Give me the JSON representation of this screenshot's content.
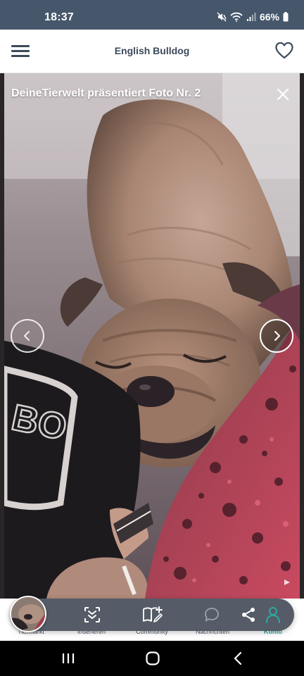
{
  "status_bar": {
    "time": "18:37",
    "battery": "66%",
    "icons": [
      "mute-icon",
      "wifi-icon",
      "signal-icon",
      "battery-icon"
    ]
  },
  "header": {
    "title": "English Bulldog",
    "menu_icon": "menu-icon",
    "favorite_icon": "heart-icon"
  },
  "viewer": {
    "caption": "DeineTierwelt präsentiert Foto Nr. 2",
    "close_icon": "close-icon",
    "prev_icon": "chevron-left-icon",
    "next_icon": "chevron-right-icon",
    "shirt_text": "BO"
  },
  "bottom_nav": {
    "items": [
      {
        "label": "Tiermarkt",
        "icon": "home-thumbnail"
      },
      {
        "label": "Inserieren",
        "icon": "collapse-icon"
      },
      {
        "label": "Community",
        "icon": "book-edit-icon"
      },
      {
        "label": "Nachrichten",
        "icon": "chat-bubble-icon"
      },
      {
        "label": "Konto",
        "icon": "user-icon",
        "active": true
      }
    ],
    "share_icon": "share-icon"
  },
  "system_nav": {
    "buttons": [
      "recent-apps-icon",
      "home-icon",
      "back-icon"
    ]
  },
  "colors": {
    "status_bar_bg": "#46576b",
    "header_text": "#3c4a5c",
    "accent": "#2ba8a0",
    "nav_pill": "#464e5a"
  }
}
